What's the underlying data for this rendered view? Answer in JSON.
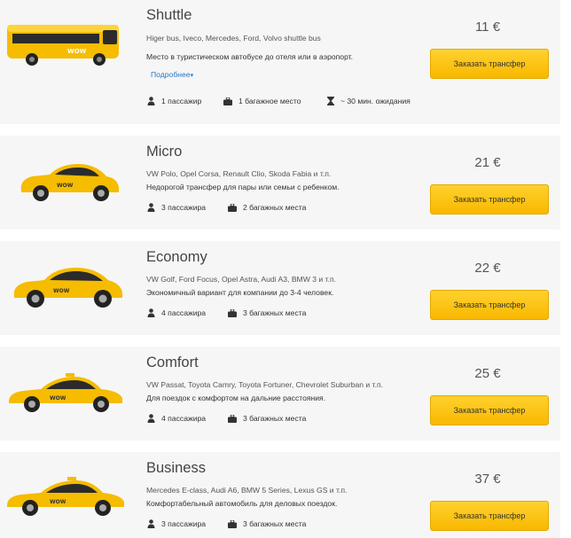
{
  "brand_color": "#f9b800",
  "cards": [
    {
      "title": "Shuttle",
      "models": "Higer bus, Iveco, Mercedes, Ford, Volvo shuttle bus",
      "description": "Место в туристическом автобусе до отеля или в аэропорт.",
      "more_link": "Подробнее",
      "features": [
        "1 пассажир",
        "1 багажное место",
        "~ 30 мин. ожидания"
      ],
      "price": "11 €",
      "button": "Заказать трансфер",
      "image": "shuttle-bus"
    },
    {
      "title": "Micro",
      "models": "VW Polo, Opel Corsa, Renault Clio, Skoda Fabia и т.п.",
      "description": "Недорогой трансфер для пары или семьи с ребенком.",
      "features": [
        "3 пассажира",
        "2 багажных места"
      ],
      "price": "21 €",
      "button": "Заказать трансфер",
      "image": "hatchback-small"
    },
    {
      "title": "Economy",
      "models": "VW Golf, Ford Focus, Opel Astra, Audi A3, BMW 3 и т.п.",
      "description": "Экономичный вариант для компании до 3-4 человек.",
      "features": [
        "4 пассажира",
        "3 багажных места"
      ],
      "price": "22 €",
      "button": "Заказать трансфер",
      "image": "hatchback"
    },
    {
      "title": "Comfort",
      "models": "VW Passat, Toyota Camry, Toyota Fortuner, Chevrolet Suburban и т.п.",
      "description": "Для поездок с комфортом на дальние расстояния.",
      "features": [
        "4 пассажира",
        "3 багажных места"
      ],
      "price": "25 €",
      "button": "Заказать трансфер",
      "image": "sedan"
    },
    {
      "title": "Business",
      "models": "Mercedes E-class, Audi A6, BMW 5 Series, Lexus GS и т.п.",
      "description": "Комфортабельный автомобиль для деловых поездок.",
      "features": [
        "3 пассажира",
        "3 багажных места"
      ],
      "price": "37 €",
      "button": "Заказать трансфер",
      "image": "sedan-business"
    }
  ]
}
